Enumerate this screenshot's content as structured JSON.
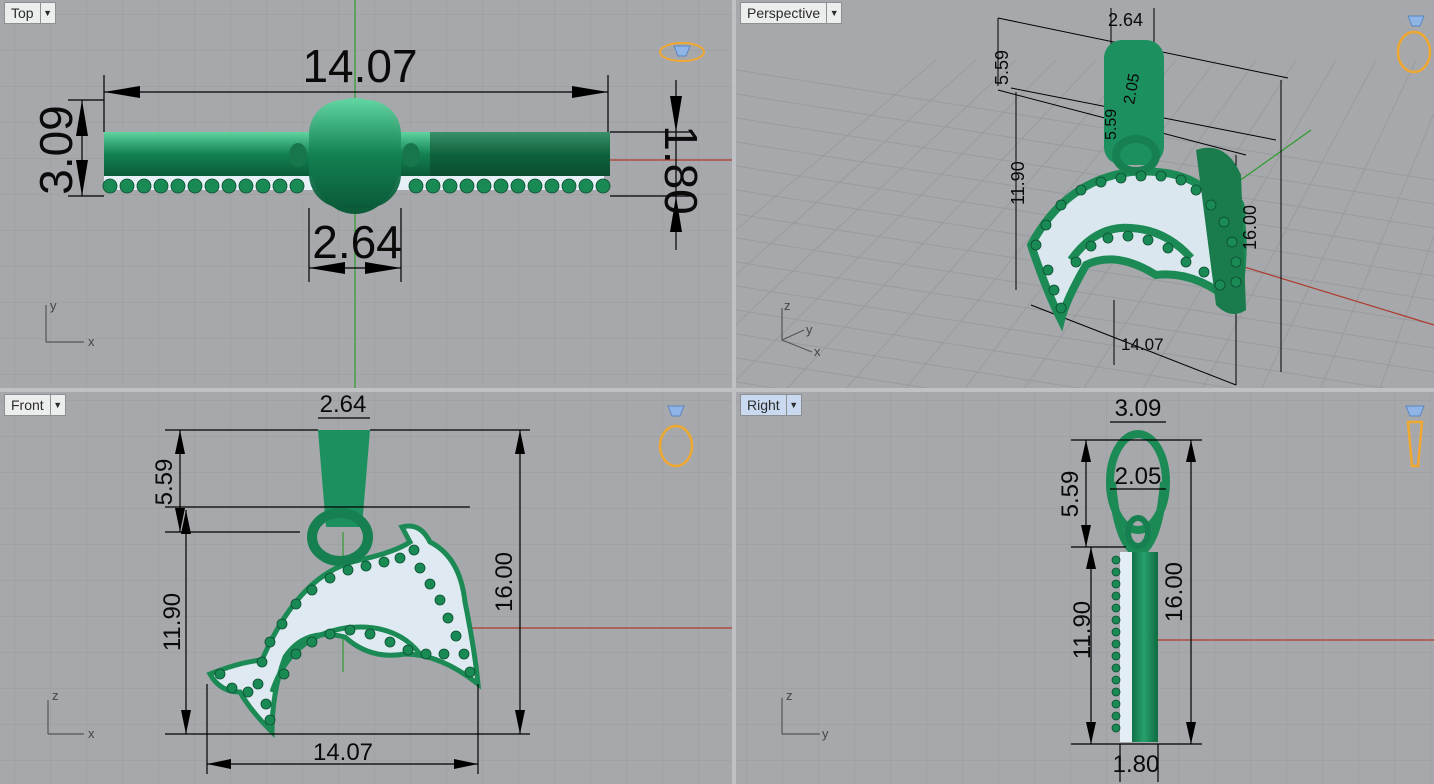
{
  "viewports": {
    "top": {
      "label": "Top"
    },
    "perspective": {
      "label": "Perspective"
    },
    "front": {
      "label": "Front"
    },
    "right": {
      "label": "Right"
    }
  },
  "dims": {
    "top": {
      "width": "14.07",
      "height": "3.09",
      "thickness": "1.80",
      "bail": "2.64"
    },
    "perspective": {
      "a": "2.64",
      "b": "2.05",
      "c": "5.59",
      "d": "5.59",
      "e": "11.90",
      "f": "16.00",
      "g": "14.07"
    },
    "front": {
      "bail": "2.64",
      "bail_h": "5.59",
      "body_h": "11.90",
      "total_h": "16.00",
      "width": "14.07"
    },
    "right": {
      "width": "3.09",
      "inner": "2.05",
      "bail_h": "5.59",
      "body_h": "11.90",
      "total_h": "16.00",
      "bottom": "1.80"
    }
  },
  "axes": {
    "x": "x",
    "y": "y",
    "z": "z"
  },
  "icons": [
    "ring-view-icon"
  ],
  "colors": {
    "viewport_bg": "#a6a8ab",
    "grid": "#9a9c9f",
    "model": "#1f8f5c",
    "dim": "#000000",
    "x_axis": "#b03a2e",
    "y_axis": "#2f9b2f",
    "ring_icon": "#f0a830"
  }
}
